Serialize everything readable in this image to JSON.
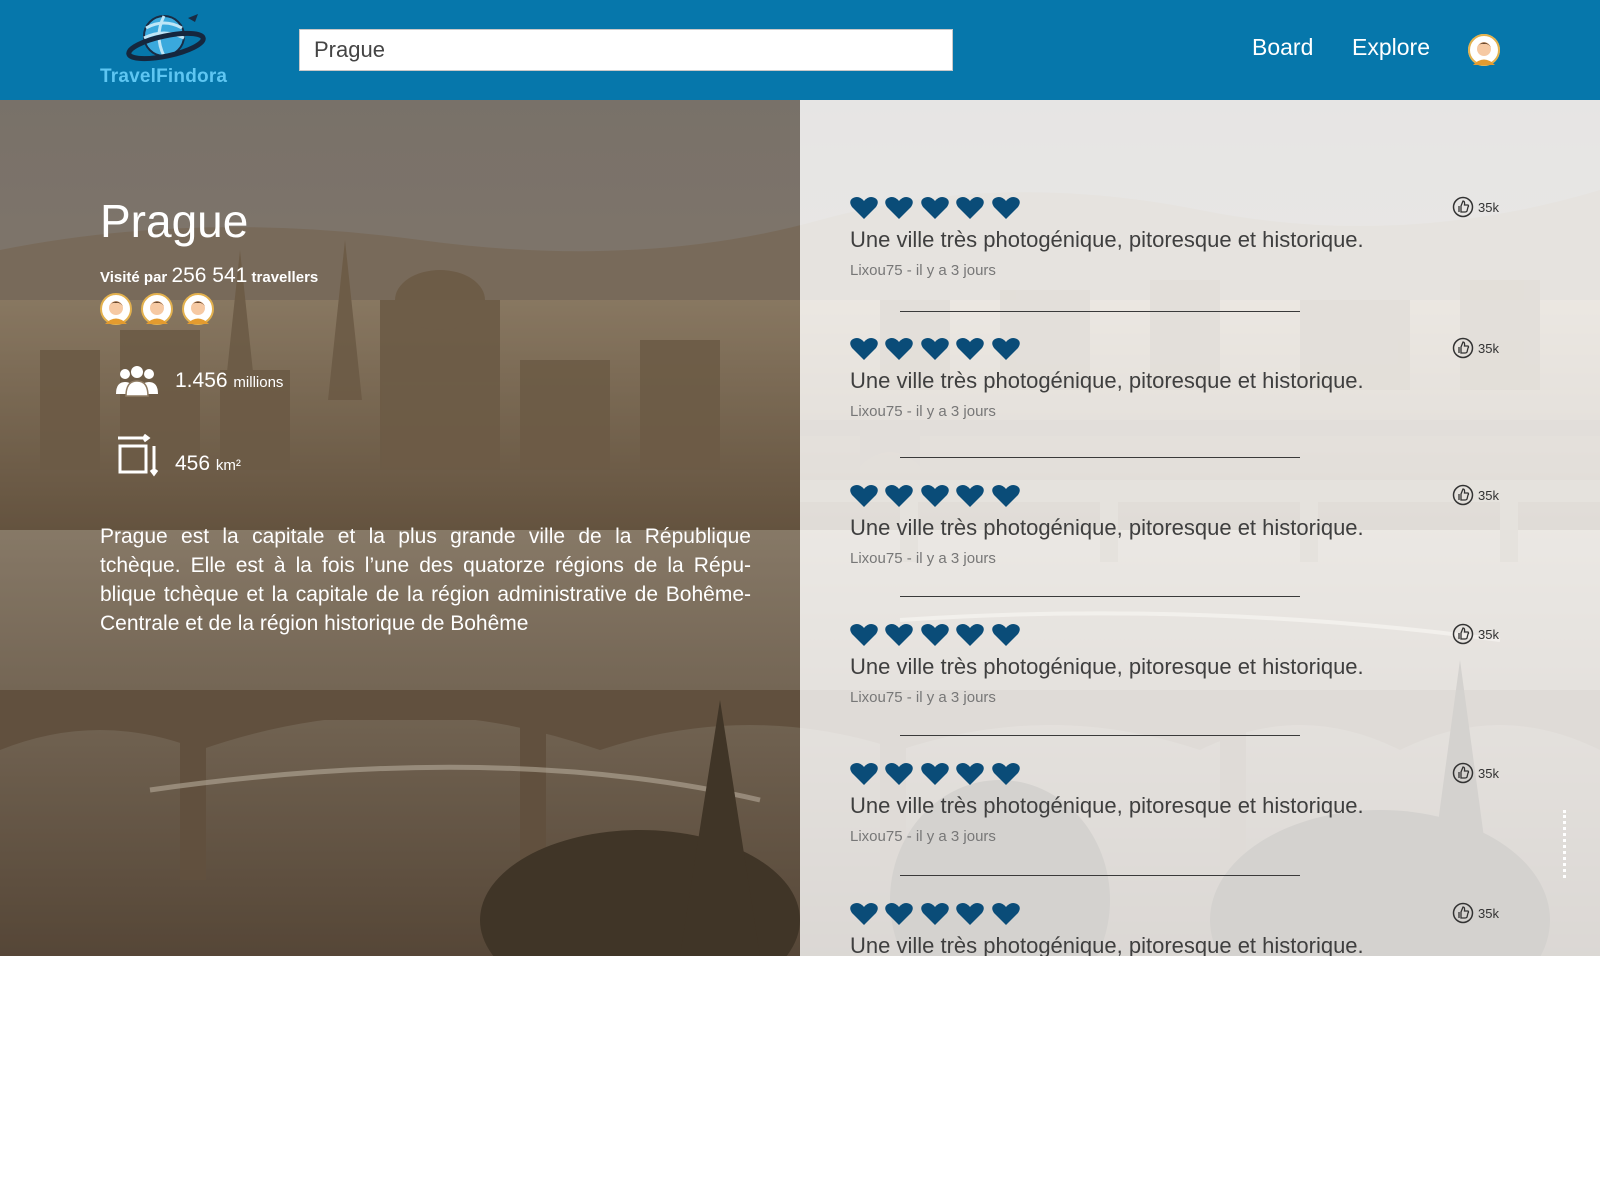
{
  "app": {
    "logo_text": "TravelFindora"
  },
  "header": {
    "search_value": "Prague",
    "nav": [
      {
        "label": "Board"
      },
      {
        "label": "Explore"
      }
    ]
  },
  "city": {
    "name": "Prague",
    "visited_prefix": "Visité par",
    "visited_count": "256 541",
    "visited_suffix": "travellers",
    "population_value": "1.456",
    "population_unit": "millions",
    "area_value": "456",
    "area_unit": "km²",
    "description": "Prague est la capitale et la plus grande ville de la République tchèque. Elle est à la fois l’une des quatorze régions de la Répu-blique tchèque et la capitale de la région administrative de Bohême-Centrale et de la région historique de Bohême"
  },
  "reviews": [
    {
      "rating": 5,
      "likes": "35k",
      "text": "Une ville très photogénique, pitoresque et historique.",
      "meta": "Lixou75 - il y a 3 jours"
    },
    {
      "rating": 5,
      "likes": "35k",
      "text": "Une ville très photogénique, pitoresque et historique.",
      "meta": "Lixou75 - il y a 3 jours"
    },
    {
      "rating": 5,
      "likes": "35k",
      "text": "Une ville très photogénique, pitoresque et historique.",
      "meta": "Lixou75 - il y a 3 jours"
    },
    {
      "rating": 5,
      "likes": "35k",
      "text": "Une ville très photogénique, pitoresque et historique.",
      "meta": "Lixou75 - il y a 3 jours"
    },
    {
      "rating": 5,
      "likes": "35k",
      "text": "Une ville très photogénique, pitoresque et historique.",
      "meta": "Lixou75 - il y a 3 jours"
    },
    {
      "rating": 5,
      "likes": "35k",
      "text": "Une ville très photogénique, pitoresque et historique.",
      "meta": ""
    }
  ],
  "colors": {
    "header_bg": "#0677ab",
    "logo_text": "#5ec6f2",
    "heart": "#0a4c78"
  },
  "icons": {
    "logo": "globe-plane-icon",
    "population": "people-group-icon",
    "area": "area-resize-icon",
    "like": "thumbs-up-icon",
    "heart": "heart-icon"
  }
}
